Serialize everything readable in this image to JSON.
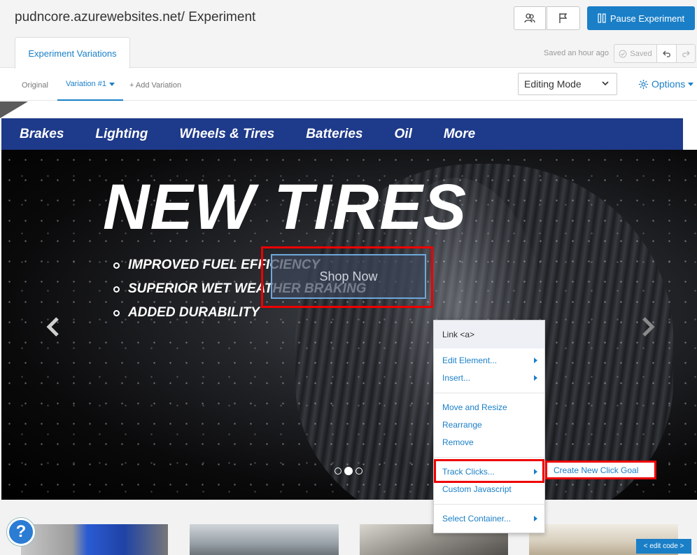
{
  "header": {
    "title": "pudncore.azurewebsites.net/ Experiment",
    "pause_label": "Pause Experiment",
    "tab_label": "Experiment Variations",
    "saved_ago": "Saved an hour ago",
    "saved_label": "Saved"
  },
  "variations": {
    "original": "Original",
    "active": "Variation #1",
    "add": "+ Add Variation",
    "mode": "Editing Mode",
    "options": "Options"
  },
  "site": {
    "nav": [
      "Brakes",
      "Lighting",
      "Wheels & Tires",
      "Batteries",
      "Oil",
      "More"
    ],
    "hero_title": "NEW TIRES",
    "bullets": [
      "IMPROVED FUEL EFFICIENCY",
      "SUPERIOR WET WEATHER BRAKING",
      "ADDED DURABILITY"
    ],
    "cta": "Shop Now"
  },
  "context_menu": {
    "header": "Link <a>",
    "items": [
      "Edit Element...",
      "Insert...",
      "Move and Resize",
      "Rearrange",
      "Remove",
      "Track Clicks...",
      "Custom Javascript",
      "Select Container..."
    ],
    "submenu": "Create New Click Goal"
  },
  "footer": {
    "help": "?",
    "edit_code": "< edit code >"
  },
  "colors": {
    "accent": "#1a7fc7",
    "nav_bg": "#1e3a8a",
    "highlight": "#e00000"
  }
}
